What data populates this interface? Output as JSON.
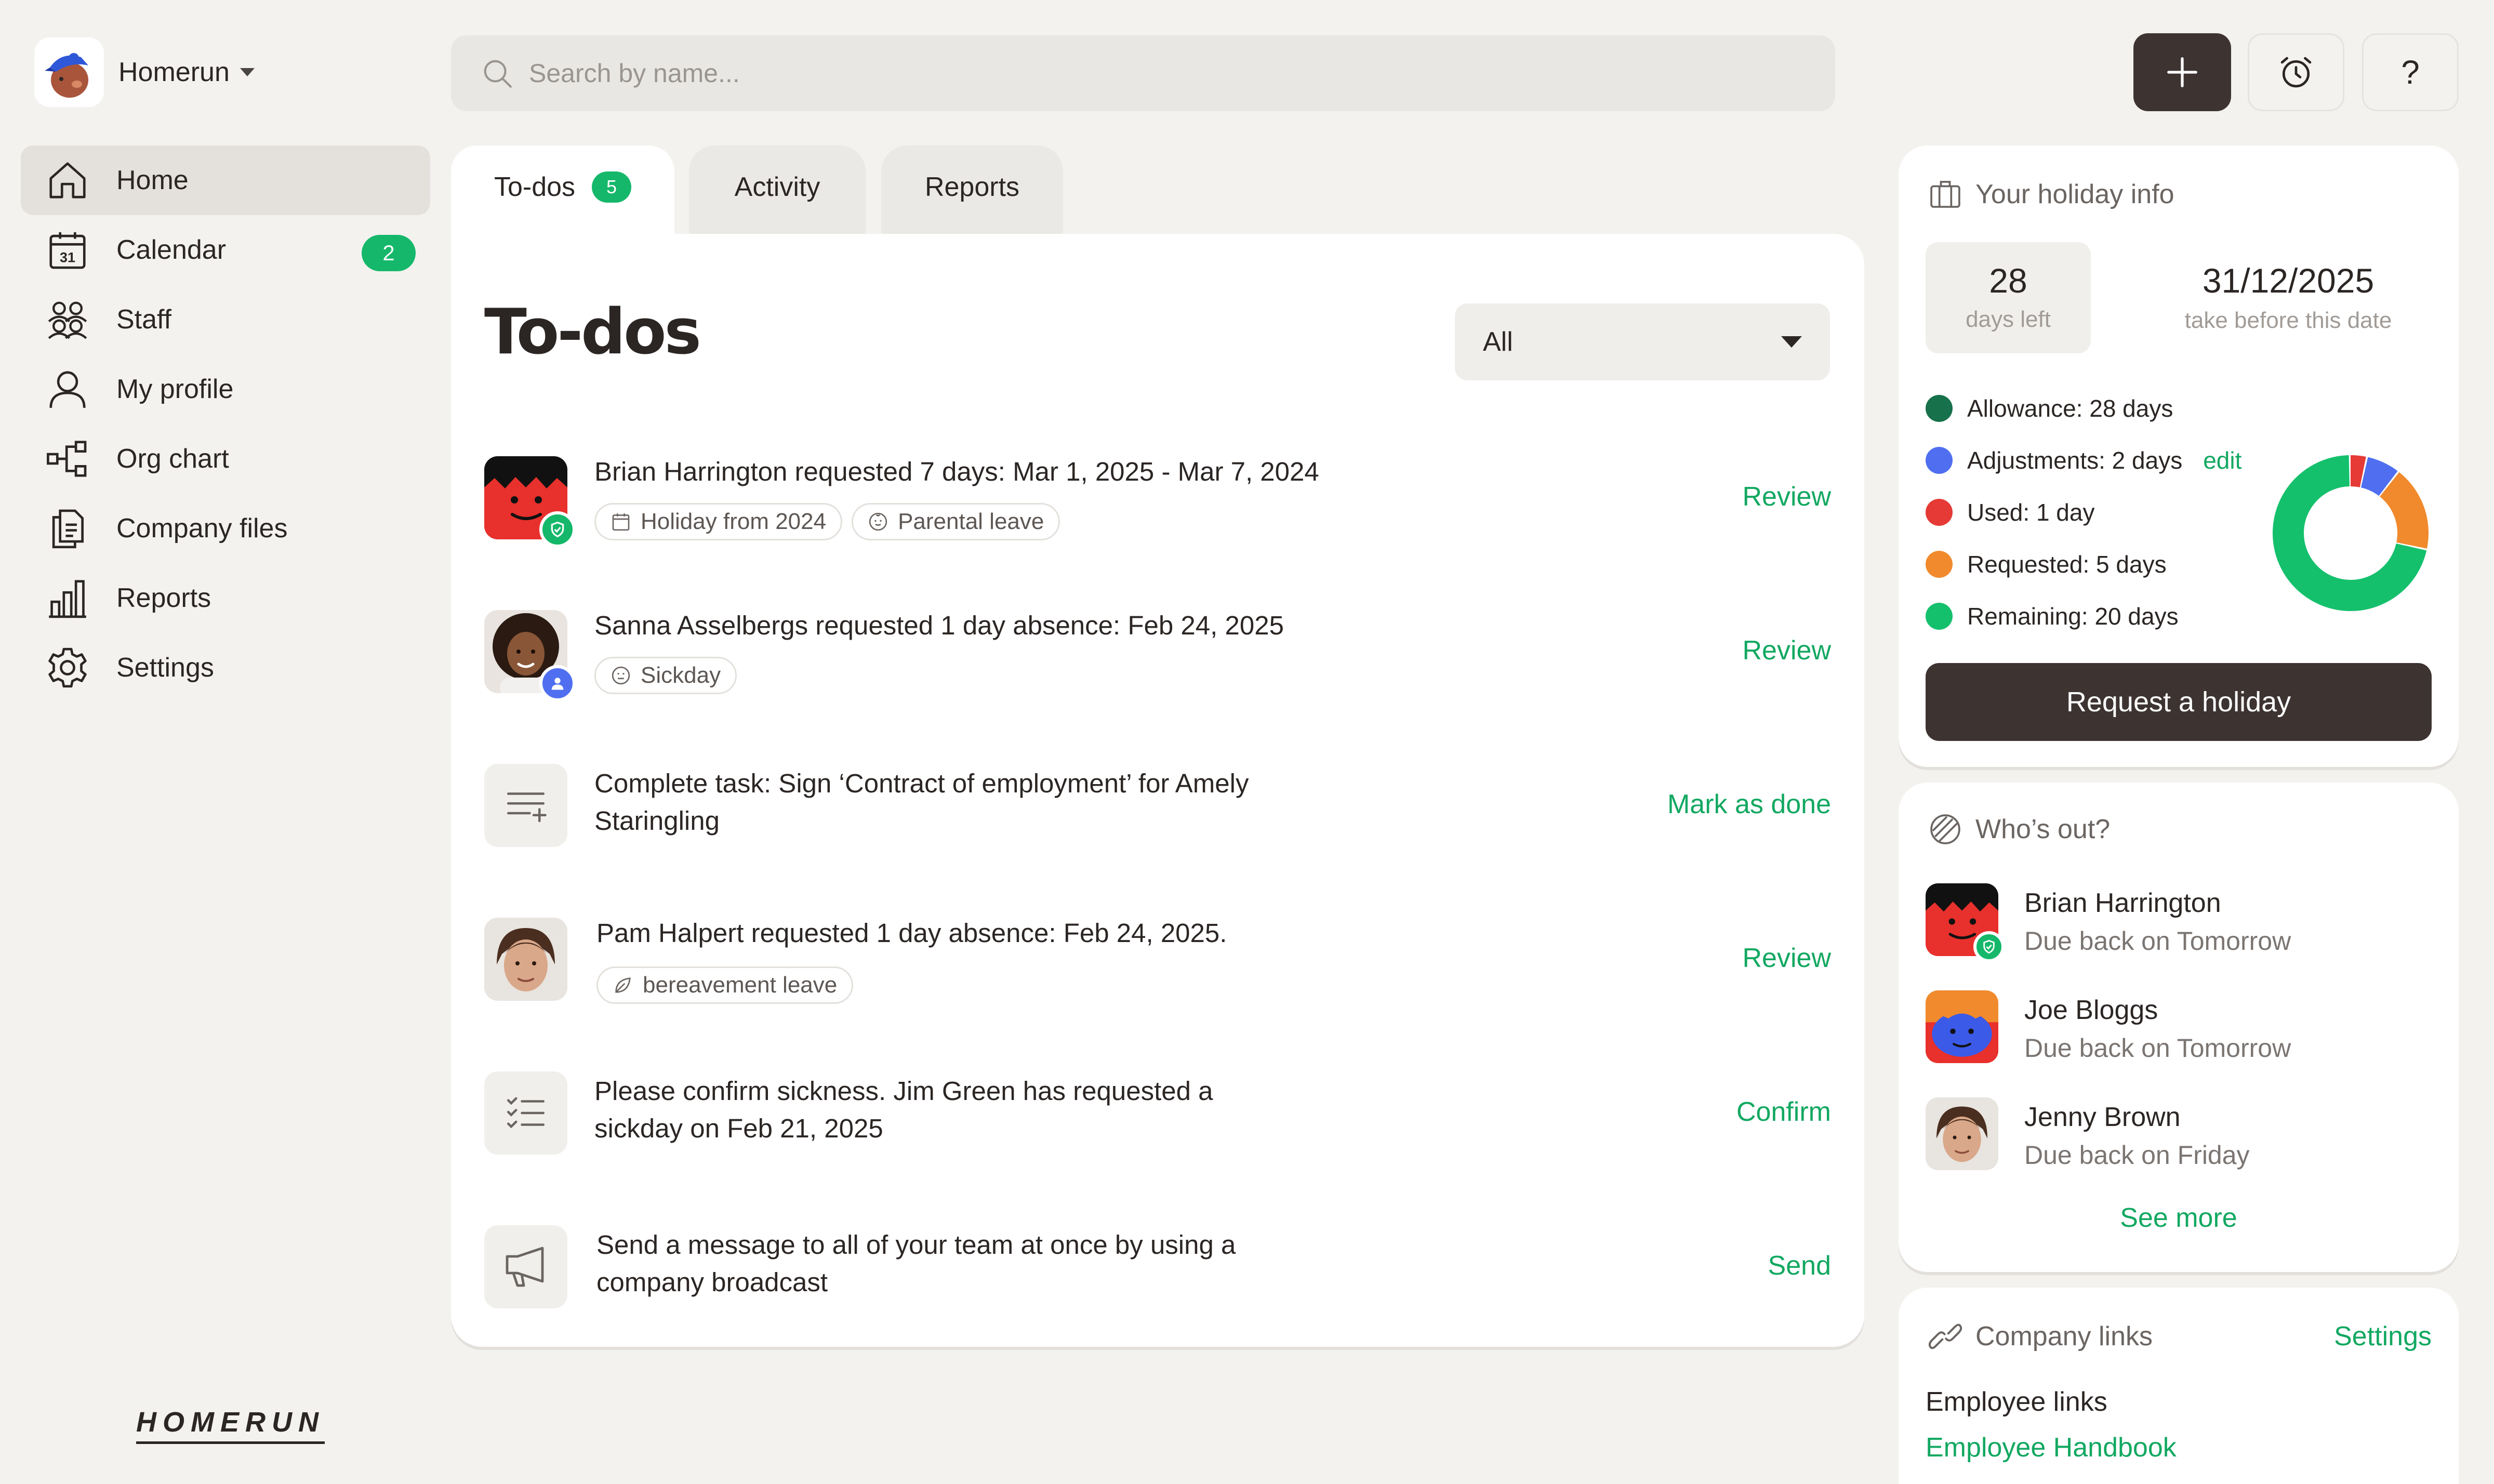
{
  "workspace": {
    "name": "Homerun"
  },
  "search": {
    "placeholder": "Search by name..."
  },
  "topbar": {
    "add_label": "+",
    "help_label": "?"
  },
  "sidebar": {
    "items": [
      {
        "label": "Home",
        "icon": "home-icon",
        "active": true
      },
      {
        "label": "Calendar",
        "icon": "calendar-icon",
        "badge": "2"
      },
      {
        "label": "Staff",
        "icon": "staff-icon"
      },
      {
        "label": "My profile",
        "icon": "user-icon"
      },
      {
        "label": "Org chart",
        "icon": "org-chart-icon"
      },
      {
        "label": "Company files",
        "icon": "files-icon"
      },
      {
        "label": "Reports",
        "icon": "bar-chart-icon"
      },
      {
        "label": "Settings",
        "icon": "gear-icon"
      }
    ],
    "calendar_icon_day": "31",
    "brand": "HOMERUN"
  },
  "tabs": [
    {
      "label": "To-dos",
      "badge": "5",
      "active": true
    },
    {
      "label": "Activity"
    },
    {
      "label": "Reports"
    }
  ],
  "main": {
    "title": "To-dos",
    "filter": {
      "value": "All"
    },
    "todos": [
      {
        "text": "Brian Harrington requested 7 days: Mar 1, 2025 - Mar 7, 2024",
        "tags": [
          "Holiday from 2024",
          "Parental leave"
        ],
        "action": "Review"
      },
      {
        "text": "Sanna Asselbergs requested 1 day absence: Feb 24, 2025",
        "tags": [
          "Sickday"
        ],
        "action": "Review"
      },
      {
        "text": "Complete task: Sign ‘Contract of employment’ for Amely Staringling",
        "action": "Mark as done"
      },
      {
        "text": "Pam Halpert requested 1 day absence: Feb 24, 2025.",
        "tags": [
          "bereavement leave"
        ],
        "action": "Review"
      },
      {
        "text": "Please confirm sickness. Jim Green has requested a sickday on Feb 21, 2025",
        "action": "Confirm"
      },
      {
        "text": "Send a message to all of your team at once by using a company broadcast",
        "action": "Send"
      }
    ]
  },
  "holiday": {
    "title": "Your holiday info",
    "days_left": "28",
    "days_left_label": "days left",
    "deadline": "31/12/2025",
    "deadline_label": "take before this date",
    "legend": [
      {
        "label": "Allowance: 28 days",
        "color": "#17714a"
      },
      {
        "label": "Adjustments: 2 days",
        "color": "#4f6ff0",
        "link": "edit"
      },
      {
        "label": "Used: 1 day",
        "color": "#e53a35"
      },
      {
        "label": "Requested: 5 days",
        "color": "#f08a2c"
      },
      {
        "label": "Remaining: 20 days",
        "color": "#15c06c"
      }
    ],
    "donut": {
      "used": 1,
      "adjustments": 2,
      "requested": 5,
      "remaining": 20
    },
    "button": "Request a holiday"
  },
  "whos_out": {
    "title": "Who’s out?",
    "people": [
      {
        "name": "Brian Harrington",
        "status": "Due back on Tomorrow"
      },
      {
        "name": "Joe Bloggs",
        "status": "Due back on Tomorrow"
      },
      {
        "name": "Jenny Brown",
        "status": "Due back on Friday"
      }
    ],
    "see_more": "See more"
  },
  "company_links": {
    "title": "Company links",
    "settings": "Settings",
    "section": "Employee links",
    "link": "Employee Handbook"
  },
  "colors": {
    "accent": "#12a861",
    "dark": "#3d3432",
    "badge": "#15b86a"
  }
}
